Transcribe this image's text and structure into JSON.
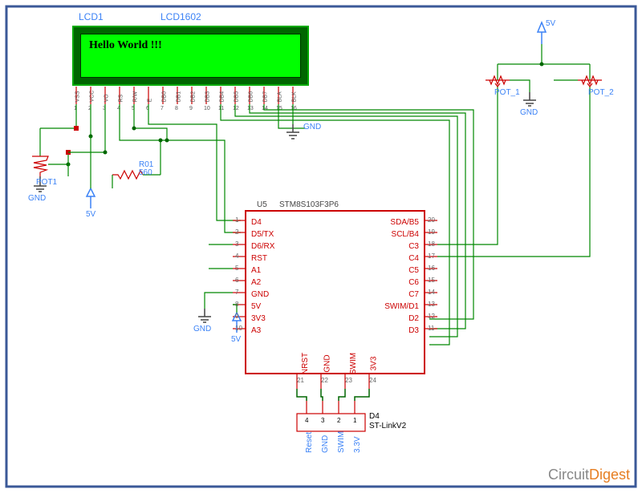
{
  "lcd": {
    "ref": "LCD1",
    "part": "LCD1602",
    "text": "Hello World !!!",
    "pins": [
      "VSS",
      "VCC",
      "VO",
      "RS",
      "R/W",
      "E",
      "DB0",
      "DB1",
      "DB2",
      "DB3",
      "DB4",
      "DB5",
      "DB6",
      "DB7",
      "BLA",
      "BLK"
    ],
    "pin_nums": [
      "1",
      "2",
      "3",
      "4",
      "5",
      "6",
      "7",
      "8",
      "9",
      "10",
      "11",
      "12",
      "13",
      "14",
      "15",
      "16"
    ]
  },
  "mcu": {
    "ref": "U5",
    "part": "STM8S103F3P6",
    "left_pins": [
      "D4",
      "D5/TX",
      "D6/RX",
      "RST",
      "A1",
      "A2",
      "GND",
      "5V",
      "3V3",
      "A3"
    ],
    "left_nums": [
      "1",
      "2",
      "3",
      "4",
      "5",
      "6",
      "7",
      "8",
      "9",
      "10"
    ],
    "right_pins": [
      "SDA/B5",
      "SCL/B4",
      "C3",
      "C4",
      "C5",
      "C6",
      "C7",
      "SWIM/D1",
      "D2",
      "D3"
    ],
    "right_nums": [
      "20",
      "19",
      "18",
      "17",
      "16",
      "15",
      "14",
      "13",
      "12",
      "11"
    ],
    "bottom_pins": [
      "NRST",
      "GND",
      "SWIM",
      "3V3"
    ],
    "bottom_nums": [
      "21",
      "22",
      "23",
      "24"
    ]
  },
  "programmer": {
    "ref": "D4",
    "part": "ST-LinkV2",
    "pins": [
      "Reset",
      "GND",
      "SWIM",
      "3.3V"
    ],
    "nums": [
      "4",
      "3",
      "2",
      "1"
    ]
  },
  "components": {
    "pot1": "POT1",
    "pot_1": "POT_1",
    "pot_2": "POT_2",
    "r01": "R01",
    "r01_val": "560",
    "v5": "5V",
    "gnd": "GND"
  },
  "watermark": {
    "a": "Circuit",
    "b": "Digest"
  }
}
